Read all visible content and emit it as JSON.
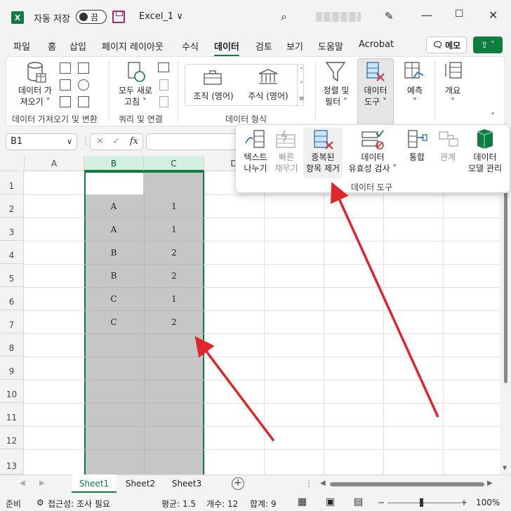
{
  "titlebar": {
    "app_logo": "X",
    "autosave_label": "자동 저장",
    "autosave_state": "끔",
    "filename": "Excel_1",
    "filename_chevron": "∨"
  },
  "tabs": [
    "파일",
    "홈",
    "삽입",
    "페이지 레이아웃",
    "수식",
    "데이터",
    "검토",
    "보기",
    "도움말",
    "Acrobat"
  ],
  "active_tab": "데이터",
  "memo_label": "메모",
  "ribbon": {
    "get_data_line1": "데이터 가",
    "get_data_line2": "져오기 ˅",
    "group_get_transform": "데이터 가져오기 및 변환",
    "refresh_line1": "모두 새로",
    "refresh_line2": "고침 ˅",
    "group_queries": "쿼리 및 연결",
    "stocks_label": "조직 (영어)",
    "currencies_label": "주식 (영어)",
    "group_data_types": "데이터 형식",
    "sort_filter_line1": "정렬 및",
    "sort_filter_line2": "필터 ˅",
    "data_tools_line1": "데이터",
    "data_tools_line2": "도구 ˅",
    "forecast_label": "예측",
    "forecast_chevron": "˅",
    "outline_label": "개요",
    "outline_chevron": "˅"
  },
  "formula_bar": {
    "name_box": "B1",
    "fx_label": "fx"
  },
  "data_tools_panel": {
    "text_to_columns_1": "텍스트",
    "text_to_columns_2": "나누기",
    "flash_fill_1": "빠른",
    "flash_fill_2": "채우기",
    "remove_dup_1": "중복된",
    "remove_dup_2": "항목 제거",
    "validation_1": "데이터",
    "validation_2": "유효성 검사 ˅",
    "consolidate": "통합",
    "relationships": "관계",
    "data_model_1": "데이터",
    "data_model_2": "모델 관리",
    "group_label": "데이터 도구"
  },
  "columns": [
    "A",
    "B",
    "C",
    "D"
  ],
  "rows": [
    "1",
    "2",
    "3",
    "4",
    "5",
    "6",
    "7",
    "8",
    "9",
    "10",
    "11",
    "12",
    "13"
  ],
  "cells": {
    "B": [
      "A",
      "A",
      "B",
      "B",
      "C",
      "C"
    ],
    "C": [
      "1",
      "1",
      "2",
      "2",
      "1",
      "2"
    ]
  },
  "sheets": [
    "Sheet1",
    "Sheet2",
    "Sheet3"
  ],
  "active_sheet": "Sheet1",
  "status": {
    "ready": "준비",
    "accessibility": "접근성: 조사 필요",
    "average": "평균: 1.5",
    "count": "개수: 12",
    "sum": "합계: 9",
    "zoom": "100%"
  },
  "colors": {
    "accent": "#107c41",
    "arrow": "#e0262a",
    "selection_fill": "#c6c6c6"
  }
}
